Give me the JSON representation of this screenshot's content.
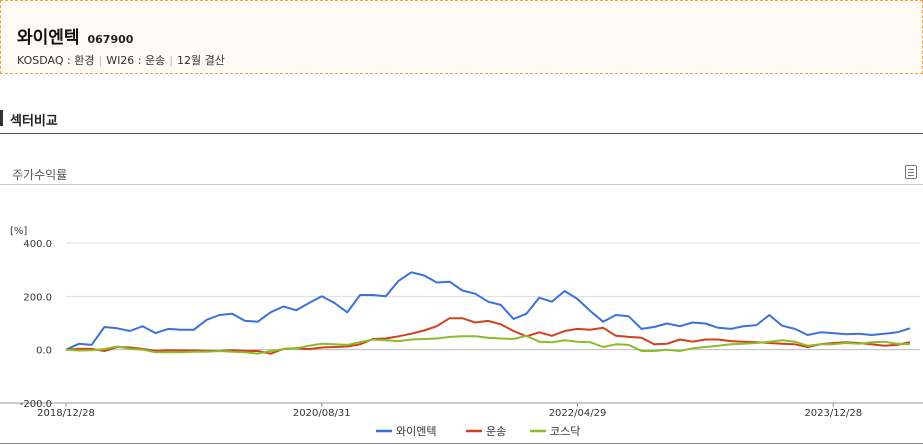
{
  "company": {
    "name": "와이엔텍",
    "code": "067900",
    "market": "KOSDAQ : 환경",
    "wics": "WI26 : 운송",
    "fiscal": "12월 결산"
  },
  "section": {
    "title": "섹터비교"
  },
  "subsection": {
    "title": "주가수익률"
  },
  "icons": {
    "menu": "menu-icon"
  },
  "colors": {
    "header_border": "#f0a040",
    "header_bg": "#fffaf3"
  },
  "chart_data": {
    "type": "line",
    "unit_label": "[%]",
    "ylim": [
      -200,
      400
    ],
    "yticks": [
      -200,
      0,
      200,
      400
    ],
    "ytick_labels": [
      "-200.0",
      "0.0",
      "200.0",
      "400.0"
    ],
    "xtick_labels": [
      "2018/12/28",
      "2020/08/31",
      "2022/04/29",
      "2023/12/28"
    ],
    "xtick_index": [
      0,
      20,
      40,
      60
    ],
    "legend_position": "bottom",
    "grid": "horizontal",
    "series": [
      {
        "name": "와이엔텍",
        "color": "#3a72d8",
        "values": [
          0,
          22,
          18,
          85,
          80,
          70,
          88,
          62,
          78,
          75,
          75,
          112,
          130,
          135,
          108,
          105,
          140,
          162,
          148,
          175,
          200,
          175,
          140,
          205,
          205,
          200,
          258,
          290,
          278,
          252,
          255,
          222,
          210,
          180,
          168,
          115,
          135,
          195,
          180,
          220,
          190,
          145,
          105,
          130,
          125,
          78,
          85,
          98,
          88,
          102,
          98,
          82,
          78,
          88,
          92,
          130,
          90,
          78,
          55,
          65,
          62,
          58,
          60,
          55,
          60,
          65,
          80
        ]
      },
      {
        "name": "운송",
        "color": "#d2401c",
        "values": [
          0,
          3,
          3,
          -5,
          10,
          8,
          3,
          -5,
          -2,
          -3,
          -3,
          -5,
          -5,
          -2,
          -5,
          -5,
          -15,
          3,
          5,
          2,
          8,
          10,
          12,
          20,
          40,
          42,
          50,
          60,
          72,
          88,
          118,
          118,
          102,
          108,
          95,
          70,
          50,
          65,
          52,
          70,
          78,
          75,
          82,
          52,
          48,
          45,
          20,
          22,
          38,
          30,
          38,
          38,
          32,
          30,
          28,
          25,
          22,
          20,
          10,
          20,
          25,
          28,
          25,
          20,
          15,
          18,
          28
        ]
      },
      {
        "name": "코스닥",
        "color": "#8cbc2c",
        "values": [
          0,
          -3,
          -2,
          2,
          12,
          3,
          0,
          -10,
          -10,
          -10,
          -8,
          -8,
          -5,
          -8,
          -10,
          -15,
          -5,
          2,
          5,
          15,
          22,
          20,
          18,
          28,
          38,
          35,
          32,
          38,
          40,
          42,
          48,
          50,
          50,
          45,
          42,
          40,
          52,
          30,
          28,
          35,
          30,
          28,
          10,
          20,
          18,
          -5,
          -5,
          0,
          -5,
          5,
          10,
          15,
          20,
          22,
          25,
          30,
          35,
          30,
          15,
          20,
          20,
          25,
          22,
          28,
          30,
          22,
          20
        ]
      }
    ]
  }
}
